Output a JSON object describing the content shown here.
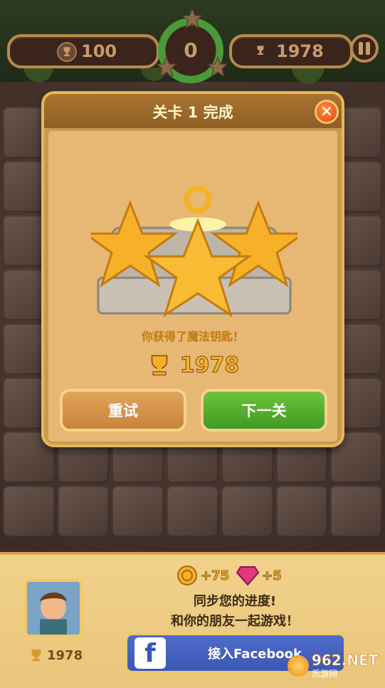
{
  "header": {
    "best_score": "100",
    "current_score": "0",
    "target_score": "1978"
  },
  "modal": {
    "title": "关卡 1 完成",
    "reward_text": "你获得了魔法钥匙！",
    "score": "1978",
    "retry_label": "重试",
    "next_label": "下一关"
  },
  "bottom": {
    "player_score": "1978",
    "coin_reward": "+75",
    "gem_reward": "+5",
    "promo_line1": "同步您的进度!",
    "promo_line2": "和你的朋友一起游戏！",
    "facebook_label": "接入Facebook"
  },
  "watermark": {
    "brand": "962.NET",
    "sub": "乐游网"
  },
  "colors": {
    "accent_gold": "#f6b12a",
    "next_green": "#4fae2c",
    "retry_orange": "#d9914a",
    "facebook_blue": "#3b58b4"
  },
  "icons": [
    "trophy-icon",
    "pause-icon",
    "close-icon",
    "star-icon",
    "coin-icon",
    "gem-icon",
    "facebook-icon"
  ]
}
